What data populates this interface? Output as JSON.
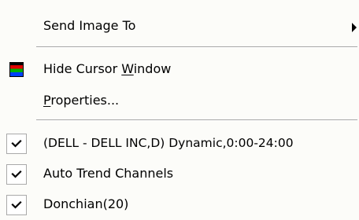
{
  "menu": {
    "send_image_to": "Send Image To",
    "hide_cursor": {
      "pre": "Hide Cursor ",
      "accel": "W",
      "post": "indow"
    },
    "properties": {
      "accel": "P",
      "post": "roperties..."
    },
    "symbol_item": "(DELL - DELL INC,D) Dynamic,0:00-24:00",
    "auto_trend": "Auto Trend Channels",
    "donchian": "Donchian(20)"
  },
  "icons": {
    "submenu": "chevron-right-icon",
    "cursor_window": "cursor-window-icon",
    "check": "checkmark-icon"
  },
  "state": {
    "symbol_item_checked": true,
    "auto_trend_checked": true,
    "donchian_checked": true
  },
  "colors": {
    "menu_background": "#fcfcf9",
    "separator": "#a8a8a8",
    "check_box_border": "#a9a9a9"
  }
}
